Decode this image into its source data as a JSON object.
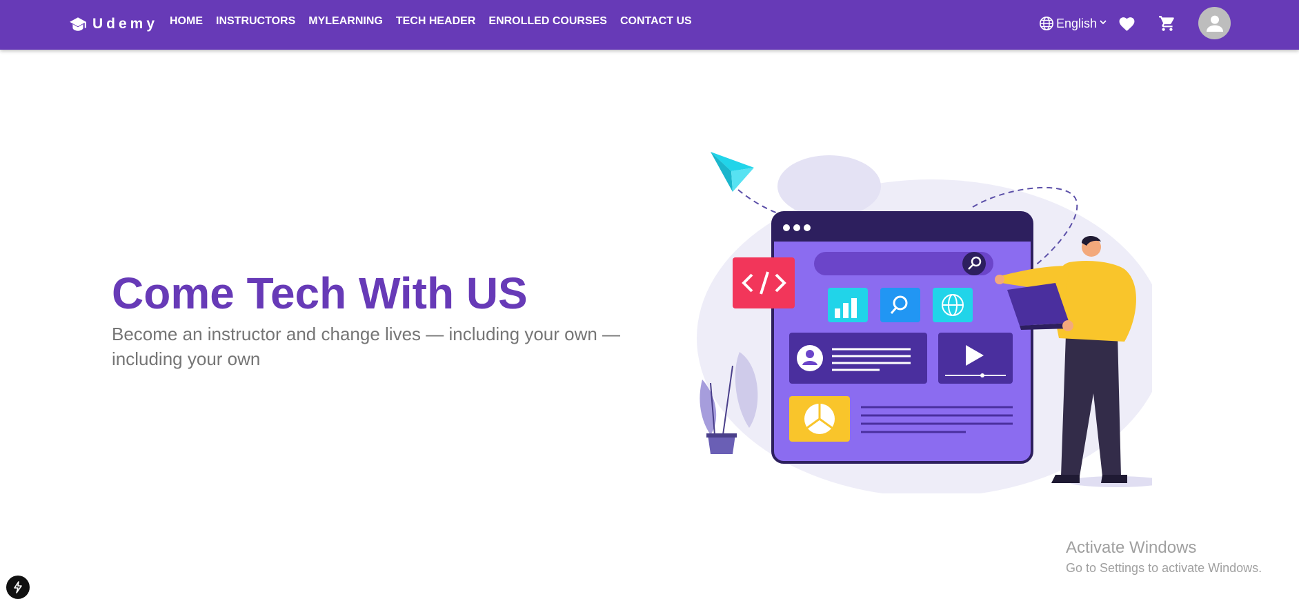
{
  "header": {
    "brand": "Udemy",
    "nav": [
      "HOME",
      "INSTRUCTORS",
      "MYLEARNING",
      "TECH HEADER",
      "ENROLLED COURSES",
      "CONTACT US"
    ],
    "language": "English",
    "icons": {
      "brand": "graduation-cap-icon",
      "language": "globe-icon",
      "language_toggle": "chevron-down-icon",
      "wishlist": "heart-icon",
      "cart": "cart-icon",
      "account": "account-icon"
    }
  },
  "hero": {
    "title": "Come Tech With US",
    "subtitle": "Become an instructor and change lives — including your own — including your own"
  },
  "watermark": {
    "title": "Activate Windows",
    "subtitle": "Go to Settings to activate Windows."
  },
  "colors": {
    "primary": "#673ab7",
    "subtitle": "#757575",
    "accent_yellow": "#f9c52b",
    "accent_red": "#f2365a",
    "accent_cyan": "#21d4e9"
  }
}
